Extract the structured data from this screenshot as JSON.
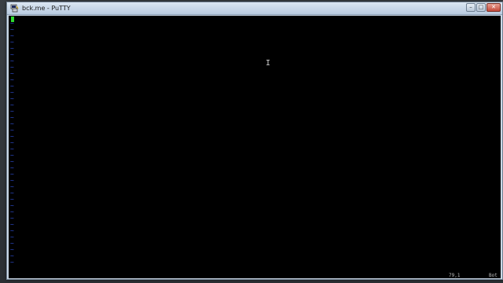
{
  "window": {
    "title": "bck.me - PuTTY",
    "icon": "putty-icon",
    "controls": {
      "minimize_glyph": "–",
      "maximize_glyph": "□",
      "close_glyph": "✕"
    }
  },
  "terminal": {
    "background": "#000000",
    "tilde_glyph": "~",
    "tilde_color": "#2f4fd6",
    "cursor_color": "#2edc2e",
    "mouse_cursor_glyph": "I",
    "status": {
      "position": "79,1",
      "where": "Bot"
    }
  }
}
